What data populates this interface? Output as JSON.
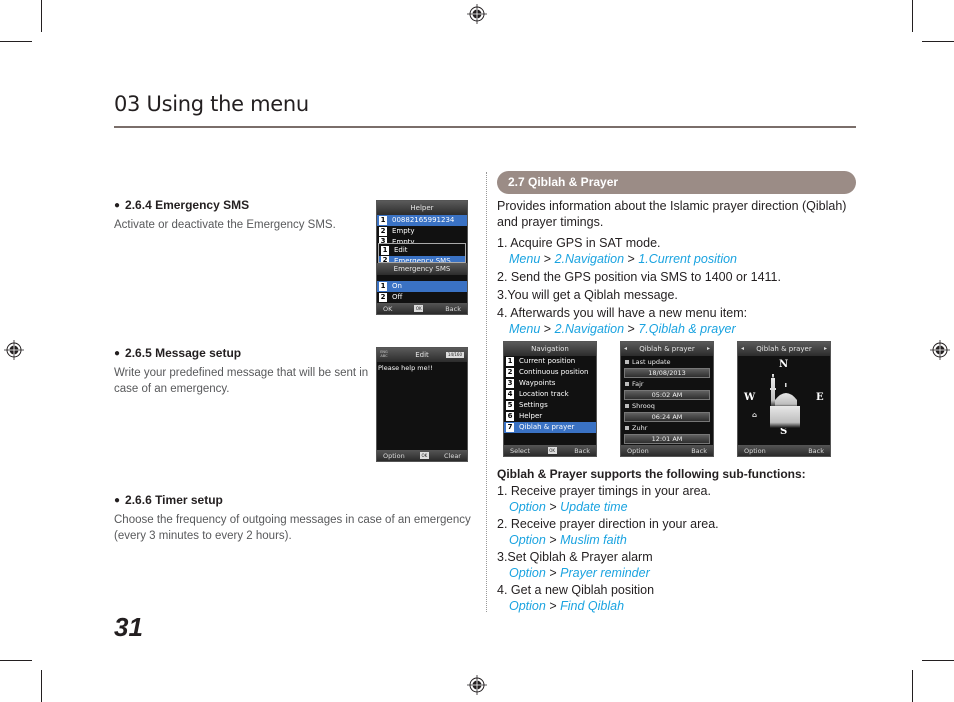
{
  "chapter": {
    "title": "03 Using the menu"
  },
  "page_number": "31",
  "left_sections": [
    {
      "heading": "2.6.4  Emergency SMS",
      "body": "Activate or deactivate the Emergency SMS.",
      "screen": {
        "title": "Helper",
        "items": [
          {
            "num": "1",
            "label": "00882165991234",
            "selected": true
          },
          {
            "num": "2",
            "label": "Empty"
          },
          {
            "num": "3",
            "label": "Empty"
          }
        ],
        "popup_items": [
          {
            "num": "1",
            "label": "Edit"
          },
          {
            "num": "2",
            "label": "Emergency SMS",
            "selected": true
          }
        ],
        "submenu_title": "Emergency SMS",
        "submenu_items": [
          {
            "num": "1",
            "label": "On",
            "selected": true
          },
          {
            "num": "2",
            "label": "Off"
          }
        ],
        "softkeys": {
          "left": "OK",
          "center": "OK",
          "right": "Back"
        }
      }
    },
    {
      "heading": "2.6.5  Message setup",
      "body": "Write your predefined message that will be sent in case of an emergency.",
      "screen": {
        "title": "Edit",
        "mode_badge": "ENG ABC",
        "counter": "14/160",
        "message": "Please help me!!",
        "softkeys": {
          "left": "Option",
          "center": "OK",
          "right": "Clear"
        }
      }
    },
    {
      "heading": "2.6.6  Timer setup",
      "body": "Choose the frequency of outgoing messages in case of an emergency (every 3 minutes to every 2 hours)."
    }
  ],
  "right_section": {
    "heading": "2.7  Qiblah & Prayer",
    "intro": "Provides information about the Islamic prayer direction (Qiblah) and prayer timings.",
    "steps": [
      {
        "text": "1. Acquire GPS in SAT mode.",
        "path": [
          "Menu",
          "2.Navigation",
          "1.Current position"
        ]
      },
      {
        "text": "2. Send the GPS position via SMS to 1400 or 1411."
      },
      {
        "text": "3.You will get a Qiblah message."
      },
      {
        "text": "4. Afterwards you will have a new menu item:",
        "path": [
          "Menu",
          "2.Navigation",
          "7.Qiblah & prayer"
        ]
      }
    ],
    "path_separator": ">",
    "screens": {
      "navigation": {
        "title": "Navigation",
        "items": [
          {
            "num": "1",
            "label": "Current position"
          },
          {
            "num": "2",
            "label": "Continuous position"
          },
          {
            "num": "3",
            "label": "Waypoints"
          },
          {
            "num": "4",
            "label": "Location track"
          },
          {
            "num": "5",
            "label": "Settings"
          },
          {
            "num": "6",
            "label": "Helper"
          },
          {
            "num": "7",
            "label": "Qiblah  & prayer",
            "selected": true
          }
        ],
        "softkeys": {
          "left": "Select",
          "center": "OK",
          "right": "Back"
        }
      },
      "prayer_times": {
        "title": "Qiblah  & prayer",
        "fields": [
          {
            "label": "Last update",
            "value": "18/08/2013"
          },
          {
            "label": "Fajr",
            "value": "05:02 AM"
          },
          {
            "label": "Shrooq",
            "value": "06:24 AM"
          },
          {
            "label": "Zuhr",
            "value": "12:01 AM"
          }
        ],
        "softkeys": {
          "left": "Option",
          "right": "Back"
        }
      },
      "compass": {
        "title": "Qiblah  & prayer",
        "directions": {
          "n": "N",
          "s": "S",
          "e": "E",
          "w": "W"
        },
        "softkeys": {
          "left": "Option",
          "right": "Back"
        }
      }
    },
    "subfunctions_heading": "Qiblah & Prayer supports the following sub-functions:",
    "subfunctions": [
      {
        "text": "1. Receive prayer timings in your area.",
        "path": [
          "Option",
          "Update time"
        ]
      },
      {
        "text": "2. Receive prayer direction in your area.",
        "path": [
          "Option",
          "Muslim faith"
        ]
      },
      {
        "text": "3.Set Qiblah & Prayer alarm",
        "path": [
          "Option",
          "Prayer reminder"
        ]
      },
      {
        "text": "4. Get a new Qiblah position",
        "path": [
          "Option",
          "Find Qiblah"
        ]
      }
    ]
  },
  "colors": {
    "link": "#1aa3e0",
    "pill": "#9b8c86",
    "rule": "#7a6e6a",
    "highlight": "#3a72c4"
  }
}
